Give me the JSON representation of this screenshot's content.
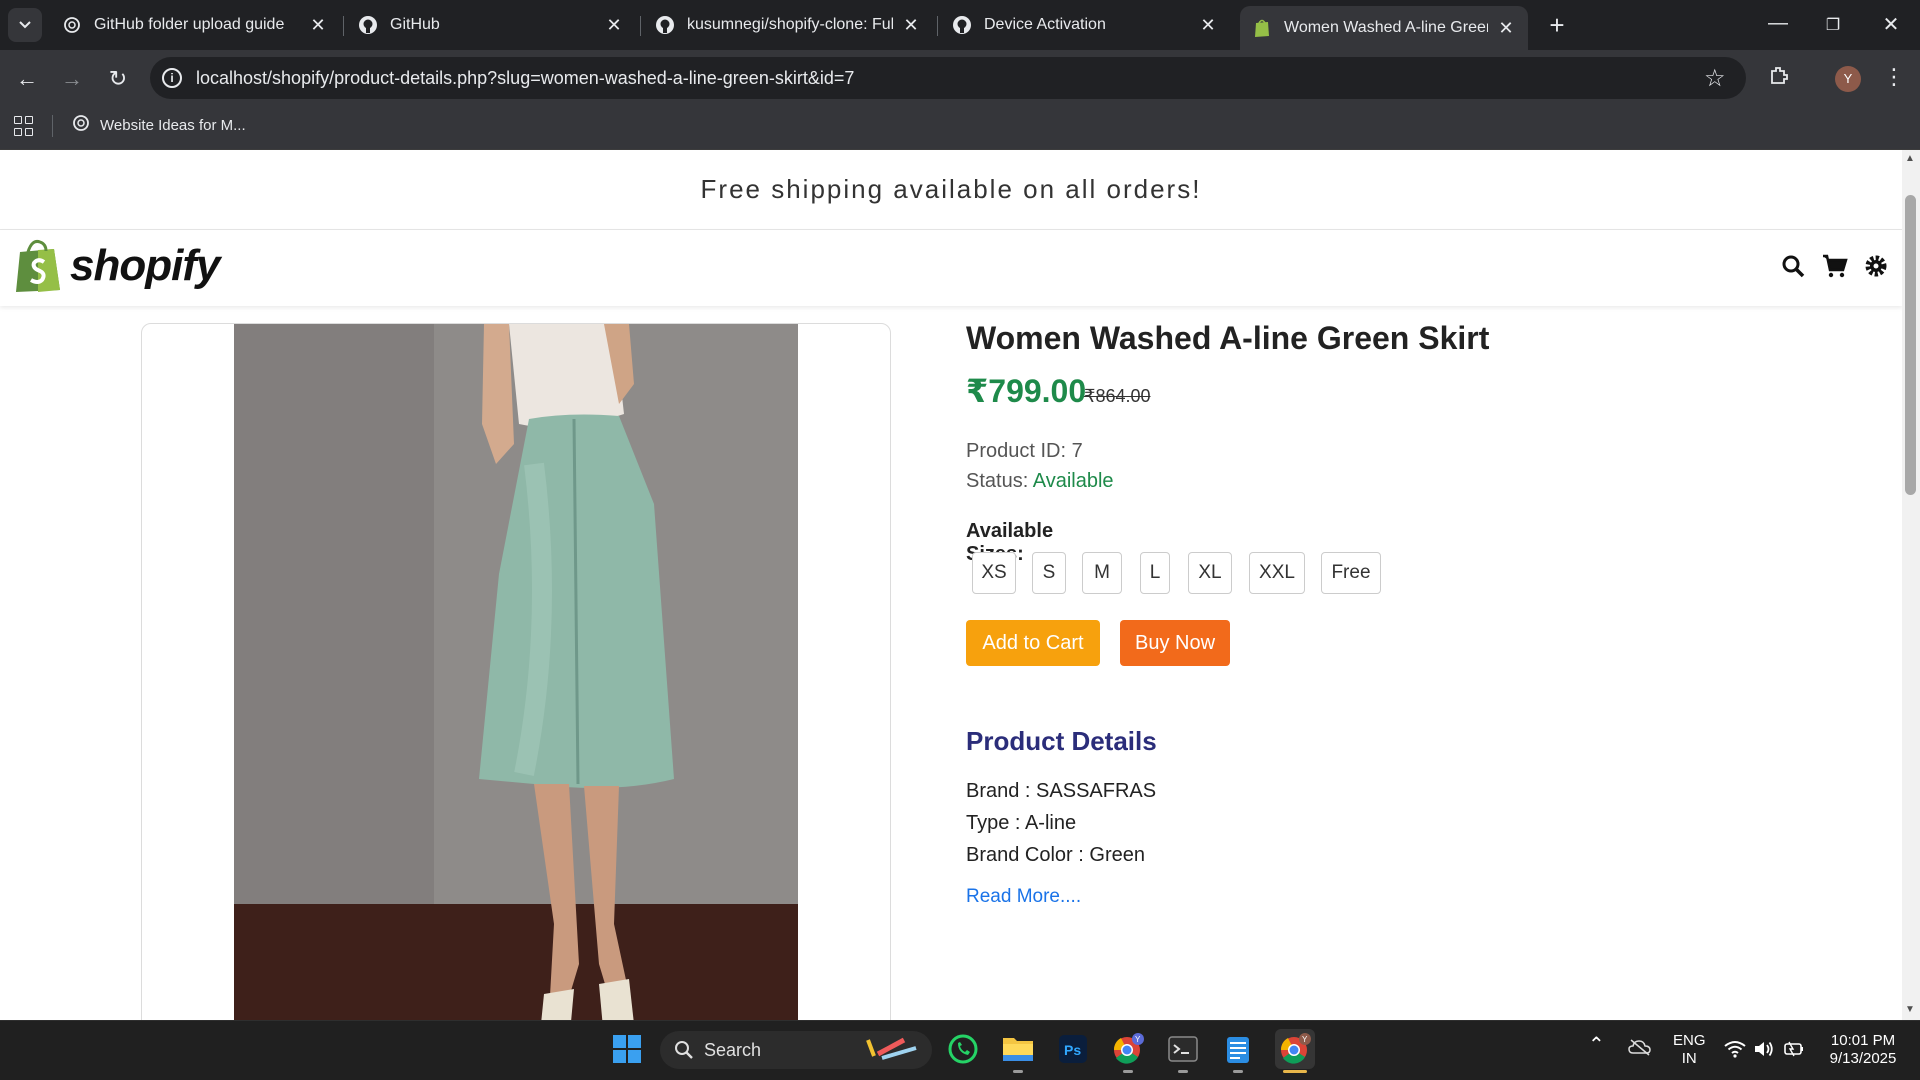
{
  "browser": {
    "tabs": [
      {
        "title": "GitHub folder upload guide",
        "icon": "openai-icon"
      },
      {
        "title": "GitHub",
        "icon": "github-icon"
      },
      {
        "title": "kusumnegi/shopify-clone: Full-s",
        "icon": "github-icon"
      },
      {
        "title": "Device Activation",
        "icon": "github-icon"
      },
      {
        "title": "Women Washed A-line Green S",
        "icon": "shopify-icon",
        "active": true
      }
    ],
    "url": "localhost/shopify/product-details.php?slug=women-washed-a-line-green-skirt&id=7",
    "profile_initial": "Y",
    "bookmarks": [
      {
        "label": "Website Ideas for M...",
        "icon": "openai-icon"
      }
    ]
  },
  "site": {
    "announcement": "Free shipping available on all orders!",
    "logo_text": "shopify"
  },
  "product": {
    "title": "Women Washed A-line Green Skirt",
    "price": "₹799.00",
    "old_price": "₹864.00",
    "id_label": "Product ID:",
    "id_value": "7",
    "status_label": "Status:",
    "status_value": "Available",
    "sizes_label": "Available Sizes:",
    "sizes": [
      "XS",
      "S",
      "M",
      "L",
      "XL",
      "XXL",
      "Free"
    ],
    "add_to_cart": "Add to Cart",
    "buy_now": "Buy Now",
    "details_title": "Product Details",
    "details": [
      {
        "label": "Brand :",
        "value": "SASSAFRAS"
      },
      {
        "label": "Type :",
        "value": "A-line"
      },
      {
        "label": "Brand Color :",
        "value": "Green"
      }
    ],
    "read_more": "Read More...."
  },
  "taskbar": {
    "search_label": "Search",
    "lang_top": "ENG",
    "lang_bottom": "IN",
    "time": "10:01 PM",
    "date": "9/13/2025"
  },
  "colors": {
    "price_green": "#1e8a4a",
    "add_to_cart": "#f7a10d",
    "buy_now": "#f26a1b",
    "details_title": "#2b2d7a",
    "link": "#1a73e8"
  }
}
